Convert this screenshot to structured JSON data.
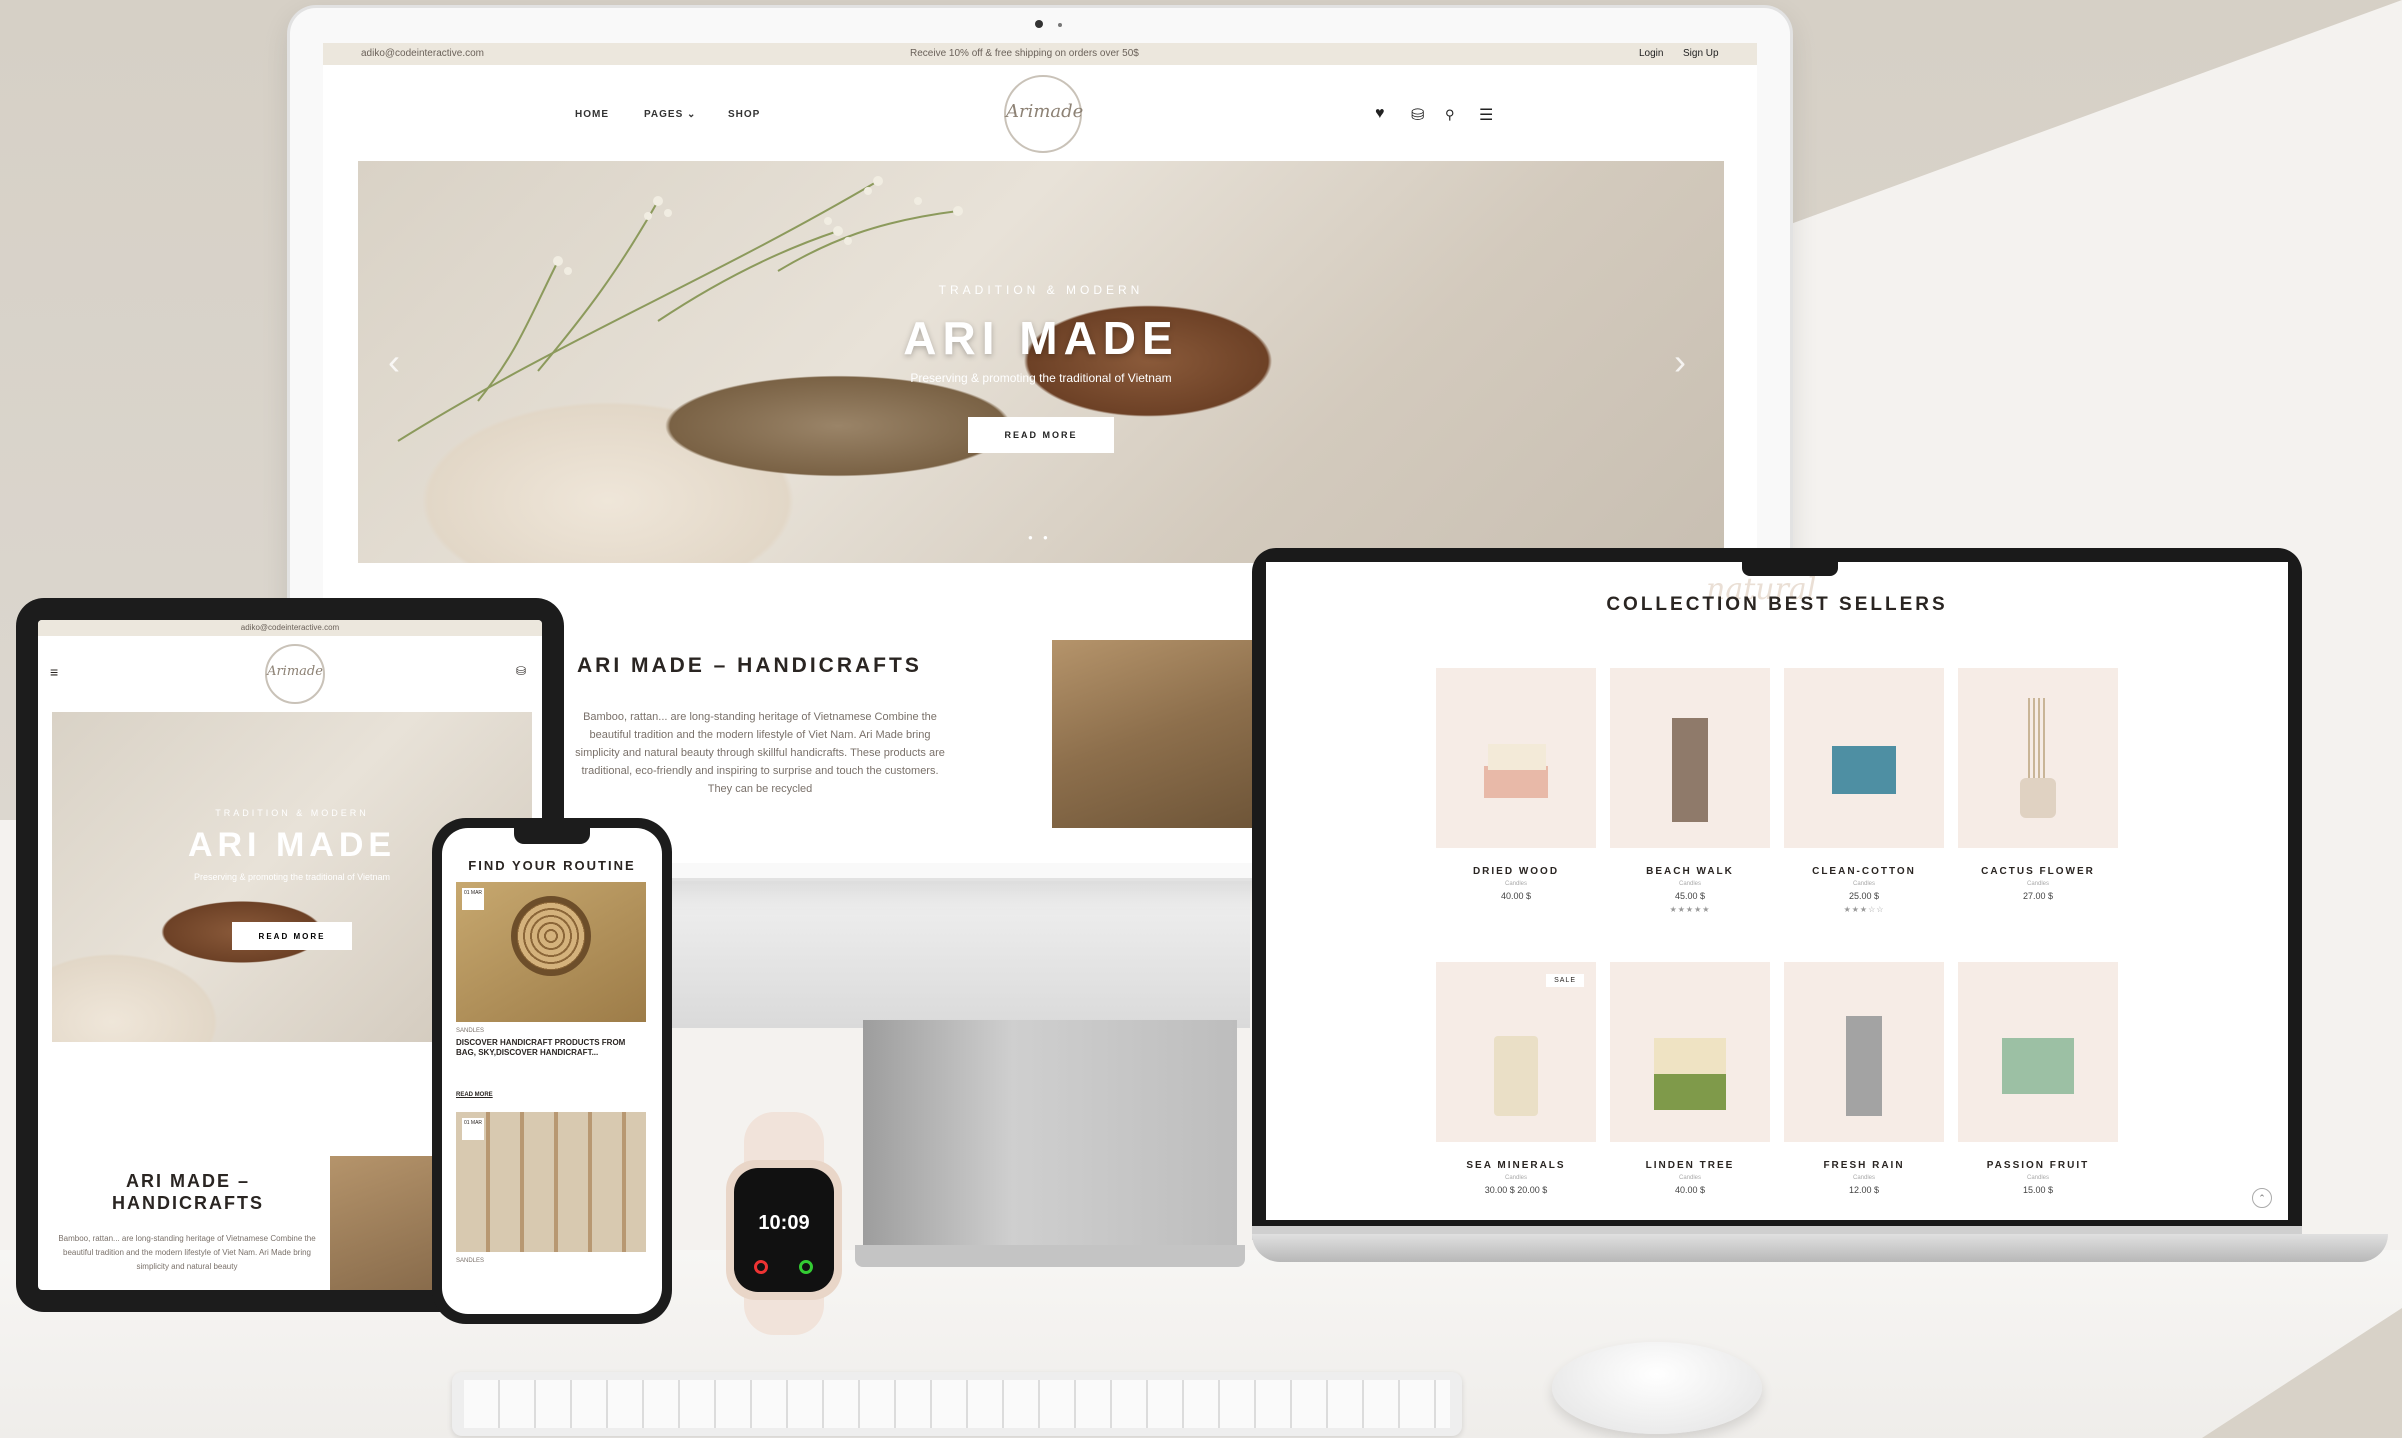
{
  "topbar": {
    "email": "adiko@codeinteractive.com",
    "promo": "Receive 10% off & free shipping on orders over 50$",
    "login": "Login",
    "signup": "Sign Up"
  },
  "nav": {
    "home": "HOME",
    "pages": "PAGES",
    "shop": "SHOP",
    "logo": "Arimade"
  },
  "hero": {
    "kicker": "TRADITION & MODERN",
    "title": "ARI MADE",
    "subtitle": "Preserving & promoting the traditional of Vietnam",
    "button": "READ MORE"
  },
  "about": {
    "title": "ARI MADE – HANDICRAFTS",
    "text": "Bamboo, rattan... are long-standing heritage of Vietnamese Combine the beautiful tradition and the modern lifestyle of Viet Nam. Ari Made bring simplicity and natural beauty through skillful handicrafts. These products are traditional, eco-friendly and inspiring to surprise and touch the customers. They can be recycled"
  },
  "tablet": {
    "email": "adiko@codeinteractive.com",
    "title_line1": "ARI MADE –",
    "title_line2": "HANDICRAFTS",
    "text": "Bamboo, rattan... are long-standing heritage of Vietnamese Combine the beautiful tradition and the modern lifestyle of Viet Nam. Ari Made bring simplicity and natural beauty"
  },
  "phone": {
    "title": "FIND YOUR ROUTINE",
    "date": "01 MAR",
    "category": "SANDLES",
    "post_title": "DISCOVER HANDICRAFT PRODUCTS FROM BAG, SKY,DISCOVER HANDICRAFT...",
    "read_more": "READ MORE"
  },
  "watch": {
    "time": "10:09"
  },
  "laptop": {
    "script": "natural",
    "title": "COLLECTION BEST SELLERS",
    "products": [
      {
        "name": "DRIED WOOD",
        "brand": "Candles",
        "price": "40.00 $",
        "stars": "",
        "sale": ""
      },
      {
        "name": "BEACH WALK",
        "brand": "Candles",
        "price": "45.00 $",
        "stars": "★★★★★",
        "sale": ""
      },
      {
        "name": "CLEAN-COTTON",
        "brand": "Candles",
        "price": "25.00 $",
        "stars": "★★★☆☆",
        "sale": ""
      },
      {
        "name": "CACTUS FLOWER",
        "brand": "Candles",
        "price": "27.00 $",
        "stars": "",
        "sale": ""
      },
      {
        "name": "SEA MINERALS",
        "brand": "Candles",
        "price": "30.00 $  20.00 $",
        "stars": "",
        "sale": "SALE"
      },
      {
        "name": "LINDEN TREE",
        "brand": "Candles",
        "price": "40.00 $",
        "stars": "",
        "sale": ""
      },
      {
        "name": "FRESH RAIN",
        "brand": "Candles",
        "price": "12.00 $",
        "stars": "",
        "sale": ""
      },
      {
        "name": "PASSION FRUIT",
        "brand": "Candles",
        "price": "15.00 $",
        "stars": "",
        "sale": ""
      }
    ]
  },
  "colors": {
    "accent": "#ece7dd",
    "card_bg": "#f6ece6",
    "text": "#2a2522"
  }
}
